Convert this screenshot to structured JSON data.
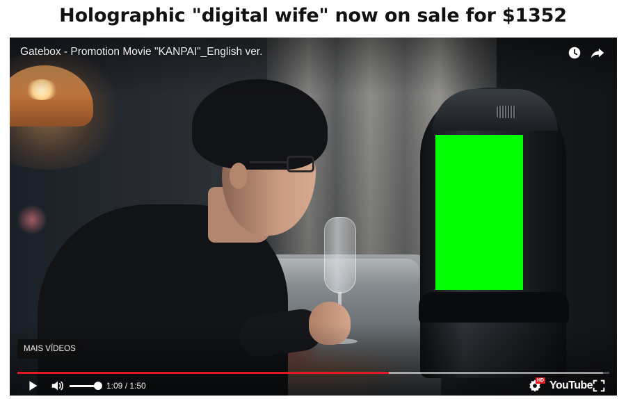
{
  "page": {
    "headline": "Holographic \"digital wife\" now on sale for $1352"
  },
  "player": {
    "video_title": "Gatebox - Promotion Movie \"KANPAI\"_English ver.",
    "watch_later_icon": "clock-icon",
    "share_icon": "share-arrow-icon",
    "more_videos_label": "MAIS VÍDEOS",
    "progress_fraction": 0.627,
    "buffered_fraction": 0.99,
    "time_current": "1:09",
    "time_separator": " / ",
    "time_total": "1:50",
    "volume_level": 1.0,
    "hd_badge": "HD",
    "youtube_label": "YouTube",
    "accent_color": "#e31b23",
    "screen_color": "#00ff00"
  }
}
